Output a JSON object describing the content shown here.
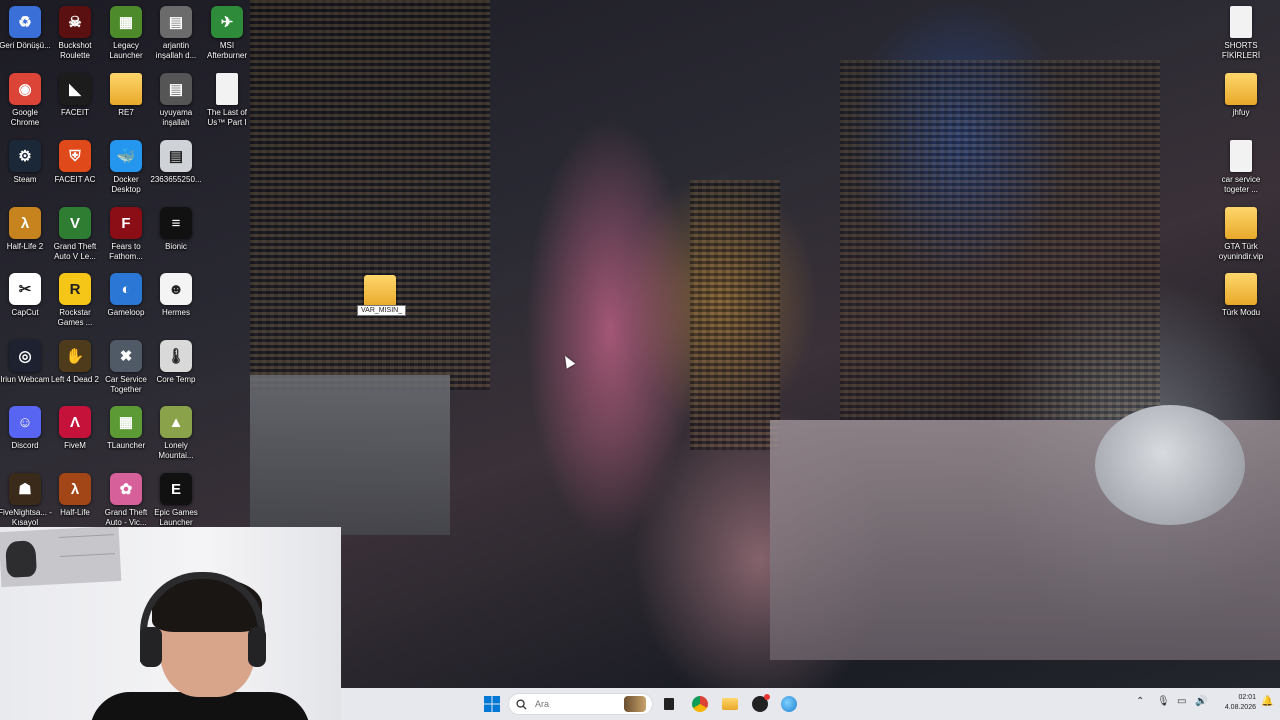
{
  "desktop": {
    "left_icons": [
      {
        "label": "Geri Dönüşü...",
        "icon": "recycle-bin-icon",
        "color": "#3a6fd8",
        "glyph": "♻"
      },
      {
        "label": "Buckshot Roulette",
        "icon": "buckshot-roulette-icon",
        "color": "#5a1010",
        "glyph": "☠"
      },
      {
        "label": "Legacy Launcher",
        "icon": "legacy-launcher-icon",
        "color": "#4c8a2c",
        "glyph": "▦"
      },
      {
        "label": "arjantin inşallah d...",
        "icon": "image-file-icon",
        "color": "#6b6b6b",
        "glyph": "▤"
      },
      {
        "label": "MSI Afterburner",
        "icon": "msi-afterburner-icon",
        "color": "#2e8b3a",
        "glyph": "✈"
      },
      {
        "label": "Google Chrome",
        "icon": "chrome-icon",
        "color": "#db4437",
        "glyph": "◉"
      },
      {
        "label": "FACEIT",
        "icon": "faceit-icon",
        "color": "#1c1c1c",
        "glyph": "◣"
      },
      {
        "label": "RE7",
        "icon": "folder-icon",
        "color": "#f2b93b",
        "glyph": ""
      },
      {
        "label": "uyuyama inşallah",
        "icon": "image-file-icon",
        "color": "#555555",
        "glyph": "▤"
      },
      {
        "label": "The Last of Us™ Part I",
        "icon": "document-icon",
        "color": "#f2f2f2",
        "glyph": ""
      },
      {
        "label": "Steam",
        "icon": "steam-icon",
        "color": "#1b2838",
        "glyph": "⚙"
      },
      {
        "label": "FACEIT AC",
        "icon": "faceit-ac-icon",
        "color": "#e0491a",
        "glyph": "⛨"
      },
      {
        "label": "Docker Desktop",
        "icon": "docker-icon",
        "color": "#2496ed",
        "glyph": "🐳"
      },
      {
        "label": "2363655250...",
        "icon": "image-file-icon",
        "color": "#cfd2d6",
        "glyph": "▤"
      },
      {
        "label": "Half-Life 2",
        "icon": "half-life-2-icon",
        "color": "#c7831e",
        "glyph": "λ"
      },
      {
        "label": "Grand Theft Auto V Le...",
        "icon": "gta-v-icon",
        "color": "#2e7d32",
        "glyph": "V"
      },
      {
        "label": "Fears to Fathom...",
        "icon": "fears-to-fathom-icon",
        "color": "#8b0d16",
        "glyph": "F"
      },
      {
        "label": "Bionic",
        "icon": "bionic-icon",
        "color": "#111111",
        "glyph": "≡"
      },
      {
        "label": "CapCut",
        "icon": "capcut-icon",
        "color": "#ffffff",
        "glyph": "✂"
      },
      {
        "label": "Rockstar Games ...",
        "icon": "rockstar-icon",
        "color": "#f5c518",
        "glyph": "R"
      },
      {
        "label": "Gameloop",
        "icon": "gameloop-icon",
        "color": "#2a77d6",
        "glyph": "◐"
      },
      {
        "label": "Hermes",
        "icon": "hermes-icon",
        "color": "#f4f4f4",
        "glyph": "☻"
      },
      {
        "label": "Iriun Webcam",
        "icon": "iriun-webcam-icon",
        "color": "#1e2230",
        "glyph": "◎"
      },
      {
        "label": "Left 4 Dead 2",
        "icon": "left-4-dead-2-icon",
        "color": "#4d3b1b",
        "glyph": "✋"
      },
      {
        "label": "Car Service Together",
        "icon": "car-service-icon",
        "color": "#505a66",
        "glyph": "✖"
      },
      {
        "label": "Core Temp",
        "icon": "core-temp-icon",
        "color": "#d9d9d9",
        "glyph": "🌡"
      },
      {
        "label": "Discord",
        "icon": "discord-icon",
        "color": "#5865f2",
        "glyph": "☺"
      },
      {
        "label": "FiveM",
        "icon": "fivem-icon",
        "color": "#c4123a",
        "glyph": "Λ"
      },
      {
        "label": "TLauncher",
        "icon": "tlauncher-icon",
        "color": "#5c9a35",
        "glyph": "▦"
      },
      {
        "label": "Lonely Mountai...",
        "icon": "lonely-mountains-icon",
        "color": "#8aa34a",
        "glyph": "▲"
      },
      {
        "label": "FiveNightsa... - Kısayol",
        "icon": "fnaf-icon",
        "color": "#3a2a1a",
        "glyph": "☗"
      },
      {
        "label": "Half-Life",
        "icon": "half-life-icon",
        "color": "#a34617",
        "glyph": "λ"
      },
      {
        "label": "Grand Theft Auto - Vic...",
        "icon": "gta-vice-city-icon",
        "color": "#d6609a",
        "glyph": "✿"
      },
      {
        "label": "Epic Games Launcher",
        "icon": "epic-games-icon",
        "color": "#111111",
        "glyph": "E"
      }
    ],
    "right_icons": [
      {
        "label": "SHORTS FİKİRLERİ",
        "icon": "document-icon"
      },
      {
        "label": "jhfuy",
        "icon": "folder-icon"
      },
      {
        "label": "car service togeter ...",
        "icon": "document-icon"
      },
      {
        "label": "GTA Türk oyunindir.vip",
        "icon": "folder-icon"
      },
      {
        "label": "Türk Modu",
        "icon": "folder-icon"
      }
    ],
    "floating_folder": {
      "label": "VAR_MISIN_",
      "icon": "folder-icon"
    }
  },
  "taskbar": {
    "search_placeholder": "Ara",
    "clock_time": "02:01",
    "clock_date": "4.08.2026",
    "accent": "#0078d4"
  }
}
